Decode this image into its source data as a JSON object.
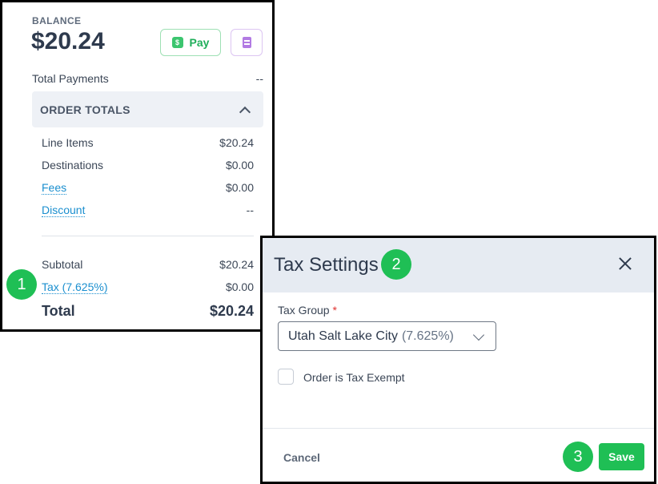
{
  "balance": {
    "label": "BALANCE",
    "amount": "$20.24",
    "pay_label": "Pay",
    "pay_icon": "dollar-badge-icon",
    "doc_icon": "document-icon"
  },
  "total_payments": {
    "label": "Total Payments",
    "value": "--"
  },
  "order_totals": {
    "header": "ORDER TOTALS",
    "lines": [
      {
        "label": "Line Items",
        "value": "$20.24"
      },
      {
        "label": "Destinations",
        "value": "$0.00"
      },
      {
        "label": "Fees",
        "value": "$0.00"
      },
      {
        "label": "Discount",
        "value": "--"
      }
    ],
    "subtotal": {
      "label": "Subtotal",
      "value": "$20.24"
    },
    "tax": {
      "label": "Tax (7.625%)",
      "value": "$0.00"
    },
    "total": {
      "label": "Total",
      "value": "$20.24"
    }
  },
  "badges": {
    "one": "1",
    "two": "2",
    "three": "3"
  },
  "modal": {
    "title": "Tax Settings",
    "tax_group_label": "Tax Group",
    "required_mark": "*",
    "tax_group_value": "Utah Salt Lake City",
    "tax_group_rate": "(7.625%)",
    "exempt_label": "Order is Tax Exempt",
    "exempt_checked": false,
    "cancel_label": "Cancel",
    "save_label": "Save"
  },
  "colors": {
    "accent_green": "#1fbf55",
    "link_blue": "#1b8fcf",
    "header_bg": "#e6ebf2",
    "purple": "#b27be3"
  }
}
